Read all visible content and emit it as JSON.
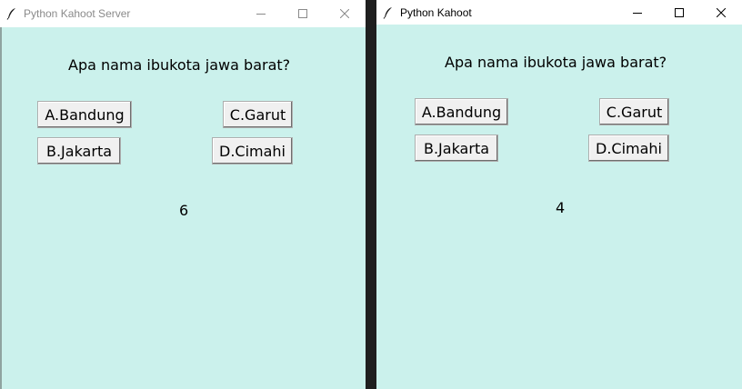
{
  "windows": [
    {
      "title": "Python Kahoot Server",
      "question": "Apa nama ibukota jawa barat?",
      "options": [
        "A.Bandung",
        "B.Jakarta",
        "C.Garut",
        "D.Cimahi"
      ],
      "timer": "6"
    },
    {
      "title": "Python Kahoot",
      "question": "Apa nama ibukota jawa barat?",
      "options": [
        "A.Bandung",
        "B.Jakarta",
        "C.Garut",
        "D.Cimahi"
      ],
      "timer": "4"
    }
  ],
  "icons": {
    "app": "feather-icon",
    "minimize": "minimize-icon",
    "maximize": "maximize-icon",
    "close": "close-icon"
  },
  "colors": {
    "client_background": "#cbf1ec",
    "button_face": "#f0f0f0",
    "titlebar": "#ffffff"
  }
}
